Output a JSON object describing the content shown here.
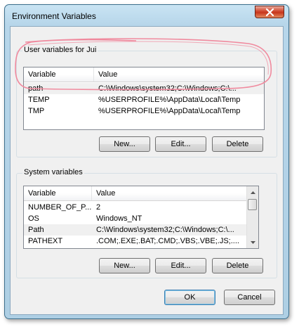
{
  "window": {
    "title": "Environment Variables",
    "close_symbol": "×"
  },
  "user_group": {
    "label": "User variables for Jui",
    "columns": [
      "Variable",
      "Value"
    ],
    "rows": [
      {
        "variable": "path",
        "value": "C:\\Windows\\system32;C:\\Windows;C:\\..."
      },
      {
        "variable": "TEMP",
        "value": "%USERPROFILE%\\AppData\\Local\\Temp"
      },
      {
        "variable": "TMP",
        "value": "%USERPROFILE%\\AppData\\Local\\Temp"
      }
    ],
    "buttons": {
      "new": "New...",
      "edit": "Edit...",
      "delete": "Delete"
    }
  },
  "system_group": {
    "label": "System variables",
    "columns": [
      "Variable",
      "Value"
    ],
    "rows": [
      {
        "variable": "NUMBER_OF_P...",
        "value": "2"
      },
      {
        "variable": "OS",
        "value": "Windows_NT"
      },
      {
        "variable": "Path",
        "value": "C:\\Windows\\system32;C:\\Windows;C:\\..."
      },
      {
        "variable": "PATHEXT",
        "value": ".COM;.EXE;.BAT;.CMD;.VBS;.VBE;.JS;...."
      }
    ],
    "buttons": {
      "new": "New...",
      "edit": "Edit...",
      "delete": "Delete"
    }
  },
  "dialog_buttons": {
    "ok": "OK",
    "cancel": "Cancel"
  },
  "annotation": {
    "color": "#f08a9e"
  },
  "icons": {
    "close": "close-icon",
    "scroll_up": "scroll-up-icon",
    "scroll_down": "scroll-down-icon"
  }
}
